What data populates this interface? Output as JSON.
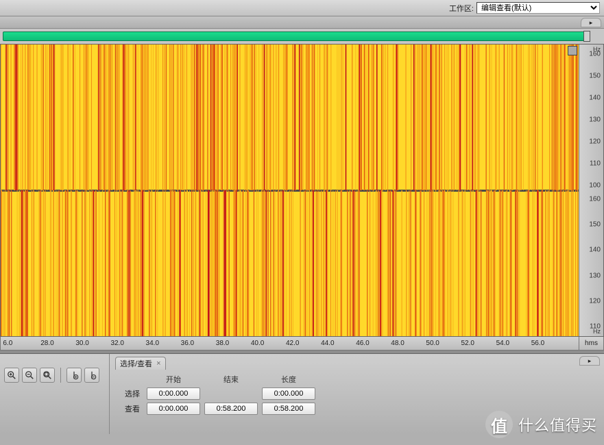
{
  "topbar": {
    "workspace_label": "工作区:",
    "workspace_value": "编辑查看(默认)"
  },
  "transport": {},
  "vruler": {
    "unit_top1": "Hz",
    "unit_bottom1": "Hz",
    "ticks_ch1": [
      "160",
      "150",
      "140",
      "130",
      "120",
      "110",
      "100"
    ],
    "ticks_ch2": [
      "160",
      "150",
      "140",
      "130",
      "120",
      "110"
    ]
  },
  "hruler": {
    "unit": "hms",
    "ticks": [
      "6.0",
      "28.0",
      "30.0",
      "32.0",
      "34.0",
      "36.0",
      "38.0",
      "40.0",
      "42.0",
      "44.0",
      "46.0",
      "48.0",
      "50.0",
      "52.0",
      "54.0",
      "56.0"
    ]
  },
  "panel": {
    "tab_title": "选择/查看",
    "headers": {
      "start": "开始",
      "end": "结束",
      "length": "长度"
    },
    "rows": {
      "select_label": "选择",
      "view_label": "查看",
      "select": {
        "start": "0:00.000",
        "end": "",
        "length": "0:00.000"
      },
      "view": {
        "start": "0:00.000",
        "end": "0:58.200",
        "length": "0:58.200"
      }
    }
  },
  "icons": {
    "zoom_in": "zoom-in-icon",
    "zoom_out": "zoom-out-icon",
    "zoom_fit": "zoom-fit-icon",
    "zoom_vin": "zoom-vertical-in-icon",
    "zoom_vout": "zoom-vertical-out-icon"
  },
  "watermark": {
    "badge": "值",
    "text": "什么值得买"
  }
}
